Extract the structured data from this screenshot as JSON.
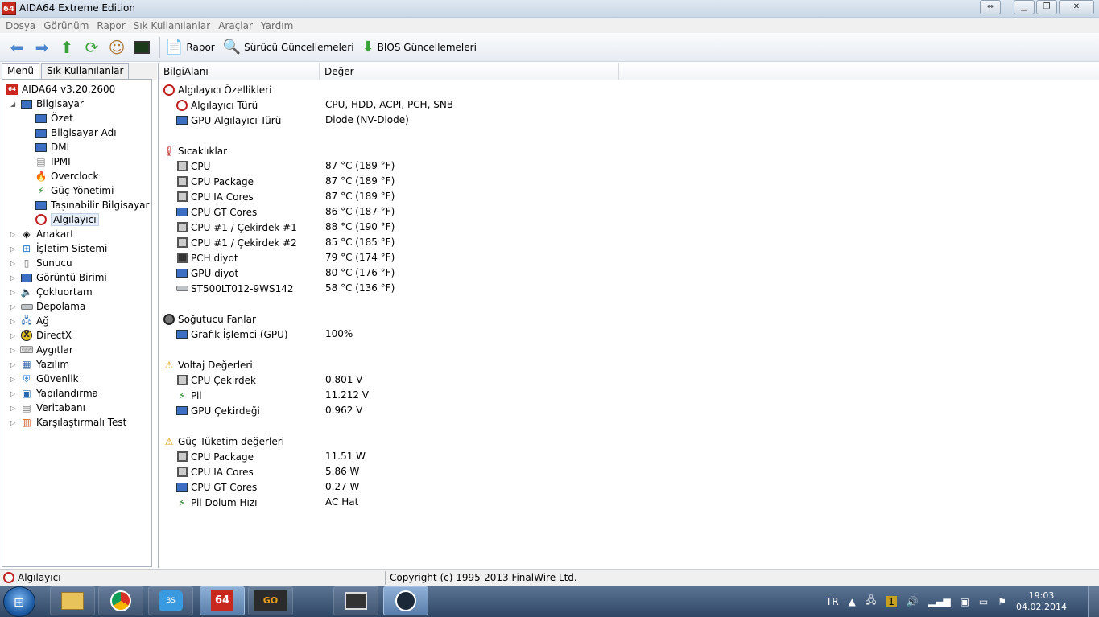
{
  "window": {
    "title": "AIDA64 Extreme Edition",
    "app_icon_text": "64"
  },
  "menubar": {
    "items": [
      "Dosya",
      "Görünüm",
      "Rapor",
      "Sık Kullanılanlar",
      "Araçlar",
      "Yardım"
    ]
  },
  "toolbar": {
    "report_label": "Rapor",
    "driver_updates_label": "Sürücü Güncellemeleri",
    "bios_updates_label": "BIOS Güncellemeleri"
  },
  "left_tabs": {
    "menu_label": "Menü",
    "favorites_label": "Sık Kullanılanlar"
  },
  "tree": {
    "root": "AIDA64 v3.20.2600",
    "computer": "Bilgisayar",
    "computer_children": [
      "Özet",
      "Bilgisayar Adı",
      "DMI",
      "IPMI",
      "Overclock",
      "Güç Yönetimi",
      "Taşınabilir Bilgisayar",
      "Algılayıcı"
    ],
    "sections": [
      "Anakart",
      "İşletim Sistemi",
      "Sunucu",
      "Görüntü Birimi",
      "Çokluortam",
      "Depolama",
      "Ağ",
      "DirectX",
      "Aygıtlar",
      "Yazılım",
      "Güvenlik",
      "Yapılandırma",
      "Veritabanı",
      "Karşılaştırmalı Test"
    ]
  },
  "columns": {
    "field": "BilgiAlanı",
    "value": "Değer"
  },
  "groups": {
    "sensor_props": {
      "title": "Algılayıcı Özellikleri",
      "rows": [
        {
          "label": "Algılayıcı Türü",
          "value": "CPU, HDD, ACPI, PCH, SNB"
        },
        {
          "label": "GPU Algılayıcı Türü",
          "value": "Diode  (NV-Diode)"
        }
      ]
    },
    "temperatures": {
      "title": "Sıcaklıklar",
      "rows": [
        {
          "label": "CPU",
          "value": "87 °C  (189 °F)"
        },
        {
          "label": "CPU Package",
          "value": "87 °C  (189 °F)"
        },
        {
          "label": "CPU IA Cores",
          "value": "87 °C  (189 °F)"
        },
        {
          "label": "CPU GT Cores",
          "value": "86 °C  (187 °F)"
        },
        {
          "label": "CPU #1 / Çekirdek #1",
          "value": "88 °C  (190 °F)"
        },
        {
          "label": "CPU #1 / Çekirdek #2",
          "value": "85 °C  (185 °F)"
        },
        {
          "label": "PCH diyot",
          "value": "79 °C  (174 °F)"
        },
        {
          "label": "GPU diyot",
          "value": "80 °C  (176 °F)"
        },
        {
          "label": "ST500LT012-9WS142",
          "value": "58 °C  (136 °F)"
        }
      ]
    },
    "fans": {
      "title": "Soğutucu Fanlar",
      "rows": [
        {
          "label": "Grafik İşlemci (GPU)",
          "value": "100%"
        }
      ]
    },
    "voltages": {
      "title": "Voltaj Değerleri",
      "rows": [
        {
          "label": "CPU Çekirdek",
          "value": "0.801 V"
        },
        {
          "label": "Pil",
          "value": "11.212 V"
        },
        {
          "label": "GPU Çekirdeği",
          "value": "0.962 V"
        }
      ]
    },
    "power": {
      "title": "Güç Tüketim değerleri",
      "rows": [
        {
          "label": "CPU Package",
          "value": "11.51 W"
        },
        {
          "label": "CPU IA Cores",
          "value": "5.86 W"
        },
        {
          "label": "CPU GT Cores",
          "value": "0.27 W"
        },
        {
          "label": "Pil Dolum Hızı",
          "value": "AC Hat"
        }
      ]
    }
  },
  "statusbar": {
    "left": "Algılayıcı",
    "right": "Copyright (c) 1995-2013 FinalWire Ltd."
  },
  "taskbar": {
    "lang": "TR",
    "time": "19:03",
    "date": "04.02.2014",
    "go_label": "GO",
    "aida_label": "64"
  },
  "colors": {
    "selection": "#e5eef8",
    "taskbar_top": "#5d7595",
    "taskbar_bottom": "#2f4765"
  }
}
